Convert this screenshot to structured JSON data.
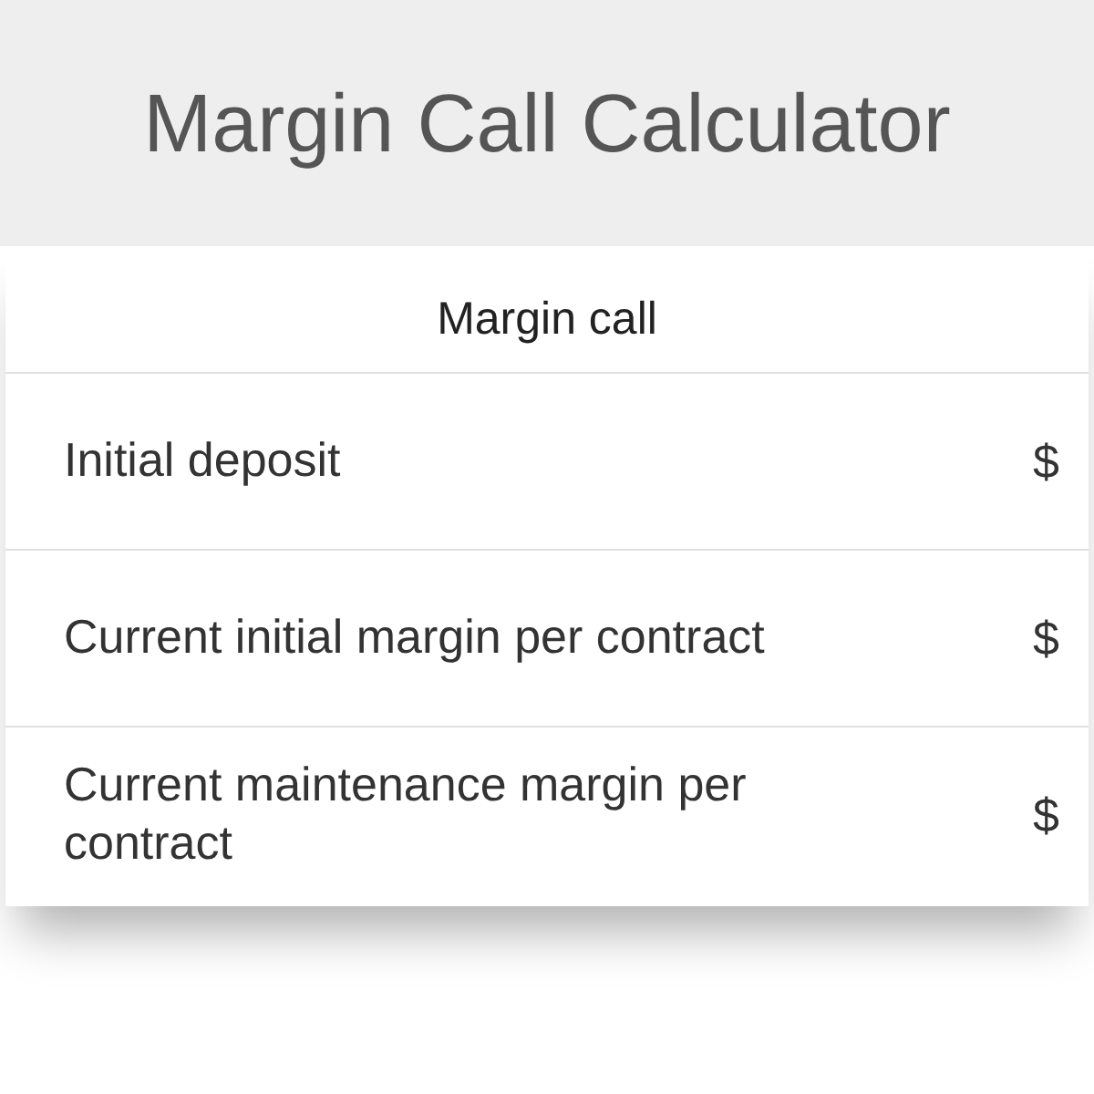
{
  "header": {
    "title": "Margin Call Calculator"
  },
  "section": {
    "title": "Margin call"
  },
  "fields": [
    {
      "label": "Initial deposit",
      "unit": "$"
    },
    {
      "label": "Current initial margin per contract",
      "unit": "$"
    },
    {
      "label": "Current maintenance margin per contract",
      "unit": "$"
    }
  ]
}
